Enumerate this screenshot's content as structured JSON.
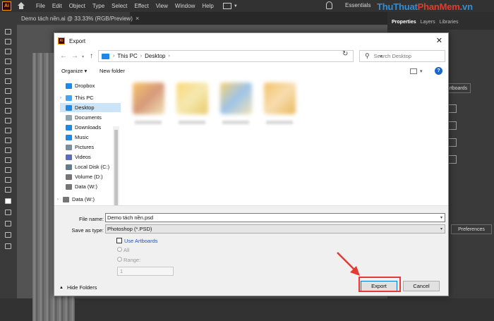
{
  "app": {
    "logo": "Ai",
    "menu": [
      "File",
      "Edit",
      "Object",
      "Type",
      "Select",
      "Effect",
      "View",
      "Window",
      "Help"
    ],
    "workspace": "Essentials",
    "document_tab": "Demo tách nền.ai @ 33.33% (RGB/Preview)",
    "document_close": "×",
    "watermark_part1": "ThuThuat",
    "watermark_part2": "PhanMem",
    "watermark_part3": ".vn"
  },
  "right_panel": {
    "tabs": [
      "Properties",
      "Layers",
      "Libraries"
    ],
    "artboards_label": "Artboards",
    "preferences_label": "Preferences"
  },
  "dialog": {
    "logo": "Ai",
    "title": "Export",
    "close": "✕",
    "breadcrumb": [
      "This PC",
      "Desktop"
    ],
    "search_placeholder": "Search Desktop",
    "organize_label": "Organize ▾",
    "new_folder_label": "New folder",
    "help_label": "?",
    "nav_items": [
      {
        "label": "Dropbox",
        "icon": "dropbox-icon",
        "color": "#1e88e5"
      },
      {
        "label": "This PC",
        "icon": "pc-icon",
        "color": "#42a5f5"
      },
      {
        "label": "Desktop",
        "icon": "desktop-icon",
        "color": "#1e88e5",
        "selected": true
      },
      {
        "label": "Documents",
        "icon": "documents-icon",
        "color": "#90a4ae"
      },
      {
        "label": "Downloads",
        "icon": "downloads-icon",
        "color": "#1e88e5"
      },
      {
        "label": "Music",
        "icon": "music-icon",
        "color": "#1e88e5"
      },
      {
        "label": "Pictures",
        "icon": "pictures-icon",
        "color": "#78909c"
      },
      {
        "label": "Videos",
        "icon": "videos-icon",
        "color": "#5c6bc0"
      },
      {
        "label": "Local Disk (C:)",
        "icon": "disk-icon",
        "color": "#607d8b"
      },
      {
        "label": "Volume (D:)",
        "icon": "disk-icon",
        "color": "#757575"
      },
      {
        "label": "Data (W:)",
        "icon": "disk-icon",
        "color": "#757575"
      },
      {
        "label": "Data (W:)",
        "icon": "disk-icon",
        "color": "#757575"
      }
    ],
    "file_name_label": "File name:",
    "file_name_value": "Demo tách nền.psd",
    "save_type_label": "Save as type:",
    "save_type_value": "Photoshop (*.PSD)",
    "use_artboards_label": "Use Artboards",
    "all_label": "All",
    "range_label": "Range:",
    "range_value": "1",
    "hide_folders_label": "Hide Folders",
    "export_label": "Export",
    "cancel_label": "Cancel"
  },
  "colors": {
    "accent": "#0078d7",
    "highlight": "#e53935",
    "link": "#1c56b0"
  }
}
